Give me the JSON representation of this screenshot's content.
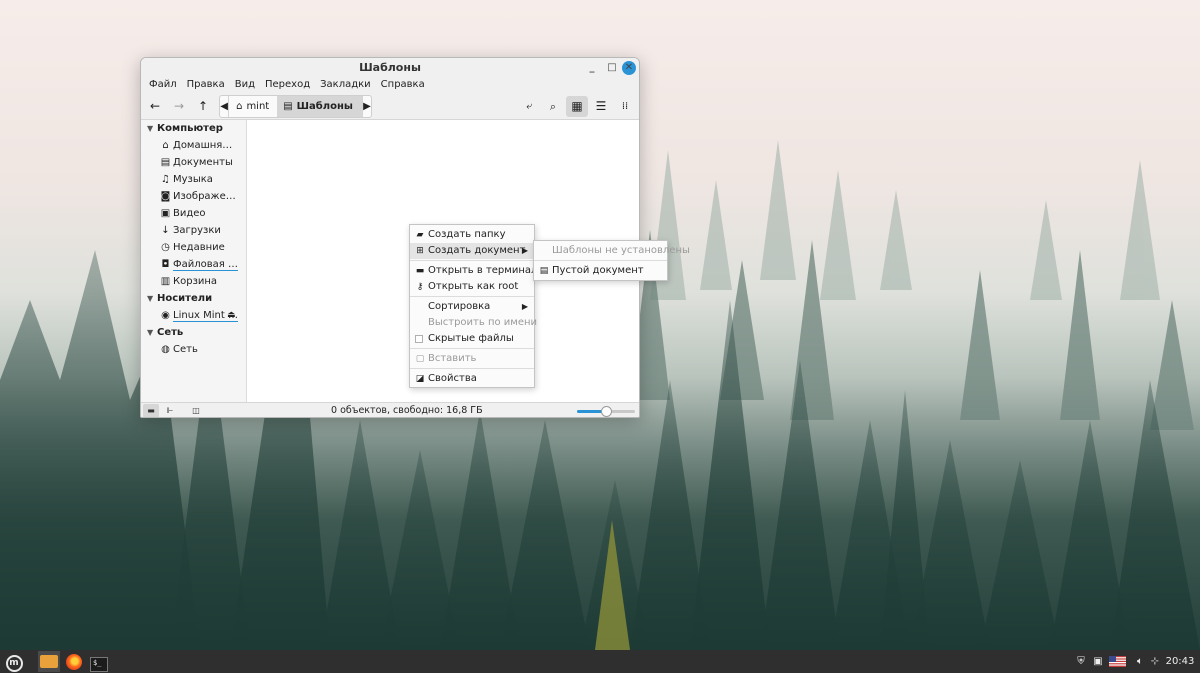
{
  "window": {
    "title": "Шаблоны",
    "controls": {
      "minimize": "_",
      "maximize": "□",
      "close": "✕"
    }
  },
  "menubar": [
    "Файл",
    "Правка",
    "Вид",
    "Переход",
    "Закладки",
    "Справка"
  ],
  "toolbar": {
    "breadcrumb": [
      {
        "label": "mint",
        "icon": "home-icon"
      },
      {
        "label": "Шаблоны",
        "icon": "document-icon"
      }
    ],
    "active_view": "icon-view"
  },
  "sidebar": {
    "sections": [
      {
        "title": "Компьютер",
        "items": [
          {
            "label": "Домашня…",
            "icon": "home-icon"
          },
          {
            "label": "Документы",
            "icon": "document-icon"
          },
          {
            "label": "Музыка",
            "icon": "music-icon"
          },
          {
            "label": "Изображе…",
            "icon": "camera-icon"
          },
          {
            "label": "Видео",
            "icon": "video-icon"
          },
          {
            "label": "Загрузки",
            "icon": "download-icon"
          },
          {
            "label": "Недавние",
            "icon": "recent-icon"
          },
          {
            "label": "Файловая …",
            "icon": "filesystem-icon"
          },
          {
            "label": "Корзина",
            "icon": "trash-icon"
          }
        ]
      },
      {
        "title": "Носители",
        "items": [
          {
            "label": "Linux Mint …",
            "icon": "disc-icon",
            "eject": true
          }
        ]
      },
      {
        "title": "Сеть",
        "items": [
          {
            "label": "Сеть",
            "icon": "network-icon"
          }
        ]
      }
    ]
  },
  "statusbar": {
    "text": "0 объектов, свободно: 16,8 ГБ",
    "zoom_fraction": 0.5
  },
  "context_menu": {
    "items": [
      {
        "label": "Создать папку",
        "icon": "new-folder-icon"
      },
      {
        "label": "Создать документ",
        "icon": "new-document-icon",
        "submenu": true,
        "highlighted": true
      },
      {
        "label": "Открыть в терминале",
        "icon": "terminal-icon"
      },
      {
        "label": "Открыть как root",
        "icon": "key-icon"
      },
      {
        "label": "Сортировка",
        "submenu": true
      },
      {
        "label": "Выстроить по имени",
        "disabled": true
      },
      {
        "label": "Скрытые файлы",
        "checkbox": true
      },
      {
        "label": "Вставить",
        "icon": "paste-icon",
        "disabled": true
      },
      {
        "label": "Свойства",
        "icon": "properties-icon"
      }
    ]
  },
  "submenu": {
    "items": [
      {
        "label": "Шаблоны не установлены",
        "disabled": true
      },
      {
        "label": "Пустой документ",
        "icon": "document-icon"
      }
    ]
  },
  "taskbar": {
    "clock": "20:43"
  }
}
